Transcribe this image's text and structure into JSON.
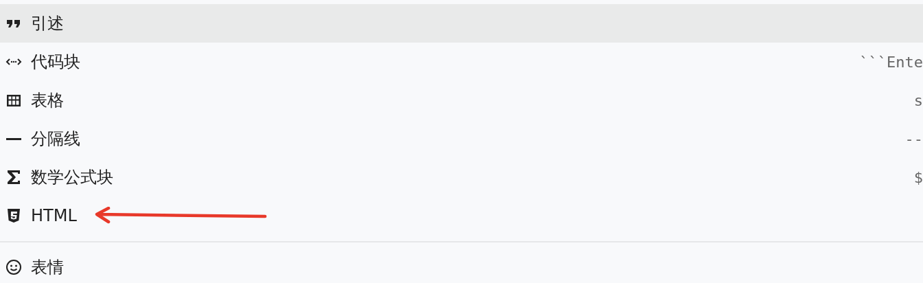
{
  "menu": {
    "groups": [
      {
        "items": [
          {
            "kind": "quote",
            "label": "引述",
            "selected": true
          },
          {
            "kind": "code",
            "label": "代码块",
            "shortcut": "```Ente",
            "selected": false
          },
          {
            "kind": "table",
            "label": "表格",
            "shortcut": "s",
            "selected": false
          },
          {
            "kind": "rule",
            "label": "分隔线",
            "shortcut": "--",
            "selected": false
          },
          {
            "kind": "math",
            "label": "数学公式块",
            "shortcut": "$",
            "selected": false
          },
          {
            "kind": "html",
            "label": "HTML",
            "selected": false
          }
        ]
      },
      {
        "items": [
          {
            "kind": "emoji",
            "label": "表情",
            "selected": false
          }
        ]
      }
    ]
  }
}
